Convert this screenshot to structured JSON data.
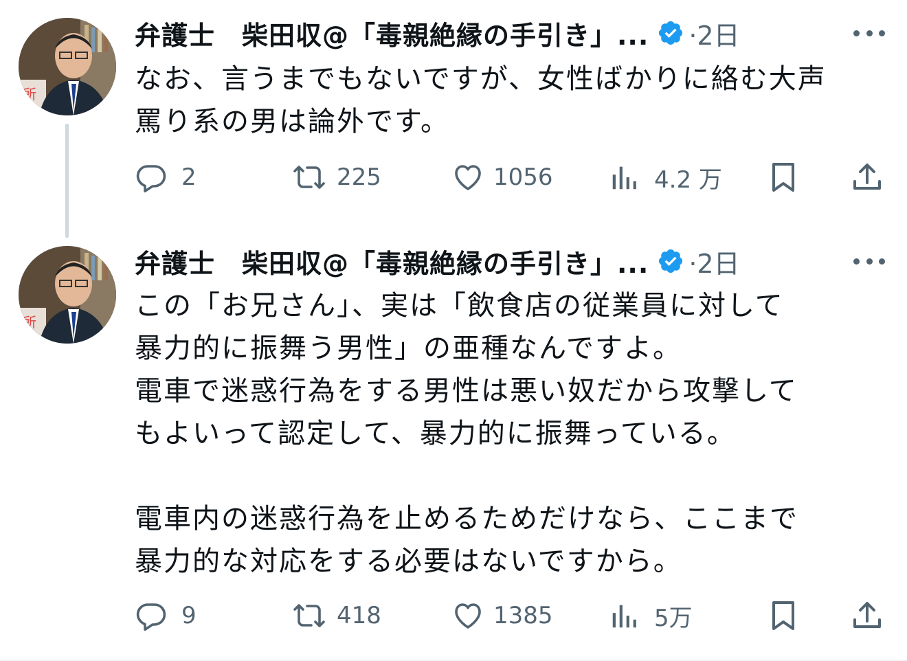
{
  "colors": {
    "verified": "#1d9bf0",
    "muted": "#536471",
    "text": "#0f1419",
    "thread_line": "#cfd9de"
  },
  "tweets": [
    {
      "author": "弁護士　柴田収@「毒親絶縁の手引き」...",
      "time": "·2日",
      "lines": [
        "なお、言うまでもないですが、女性ばかりに絡む大声",
        "罵り系の男は論外です。"
      ],
      "replies": "2",
      "retweets": "225",
      "likes": "1056",
      "views": "4.2 万"
    },
    {
      "author": "弁護士　柴田収@「毒親絶縁の手引き」...",
      "time": "·2日",
      "lines": [
        "この「お兄さん」、実は「飲食店の従業員に対して",
        "暴力的に振舞う男性」の亜種なんですよ。",
        "電車で迷惑行為をする男性は悪い奴だから攻撃して",
        "もよいって認定して、暴力的に振舞っている。",
        "",
        "電車内の迷惑行為を止めるためだけなら、ここまで",
        "暴力的な対応をする必要はないですから。"
      ],
      "replies": "9",
      "retweets": "418",
      "likes": "1385",
      "views": "5万"
    }
  ],
  "icons": [
    "avatar-photo",
    "verified-badge-icon",
    "more-icon",
    "reply-icon",
    "retweet-icon",
    "like-icon",
    "views-icon",
    "bookmark-icon",
    "share-icon"
  ]
}
